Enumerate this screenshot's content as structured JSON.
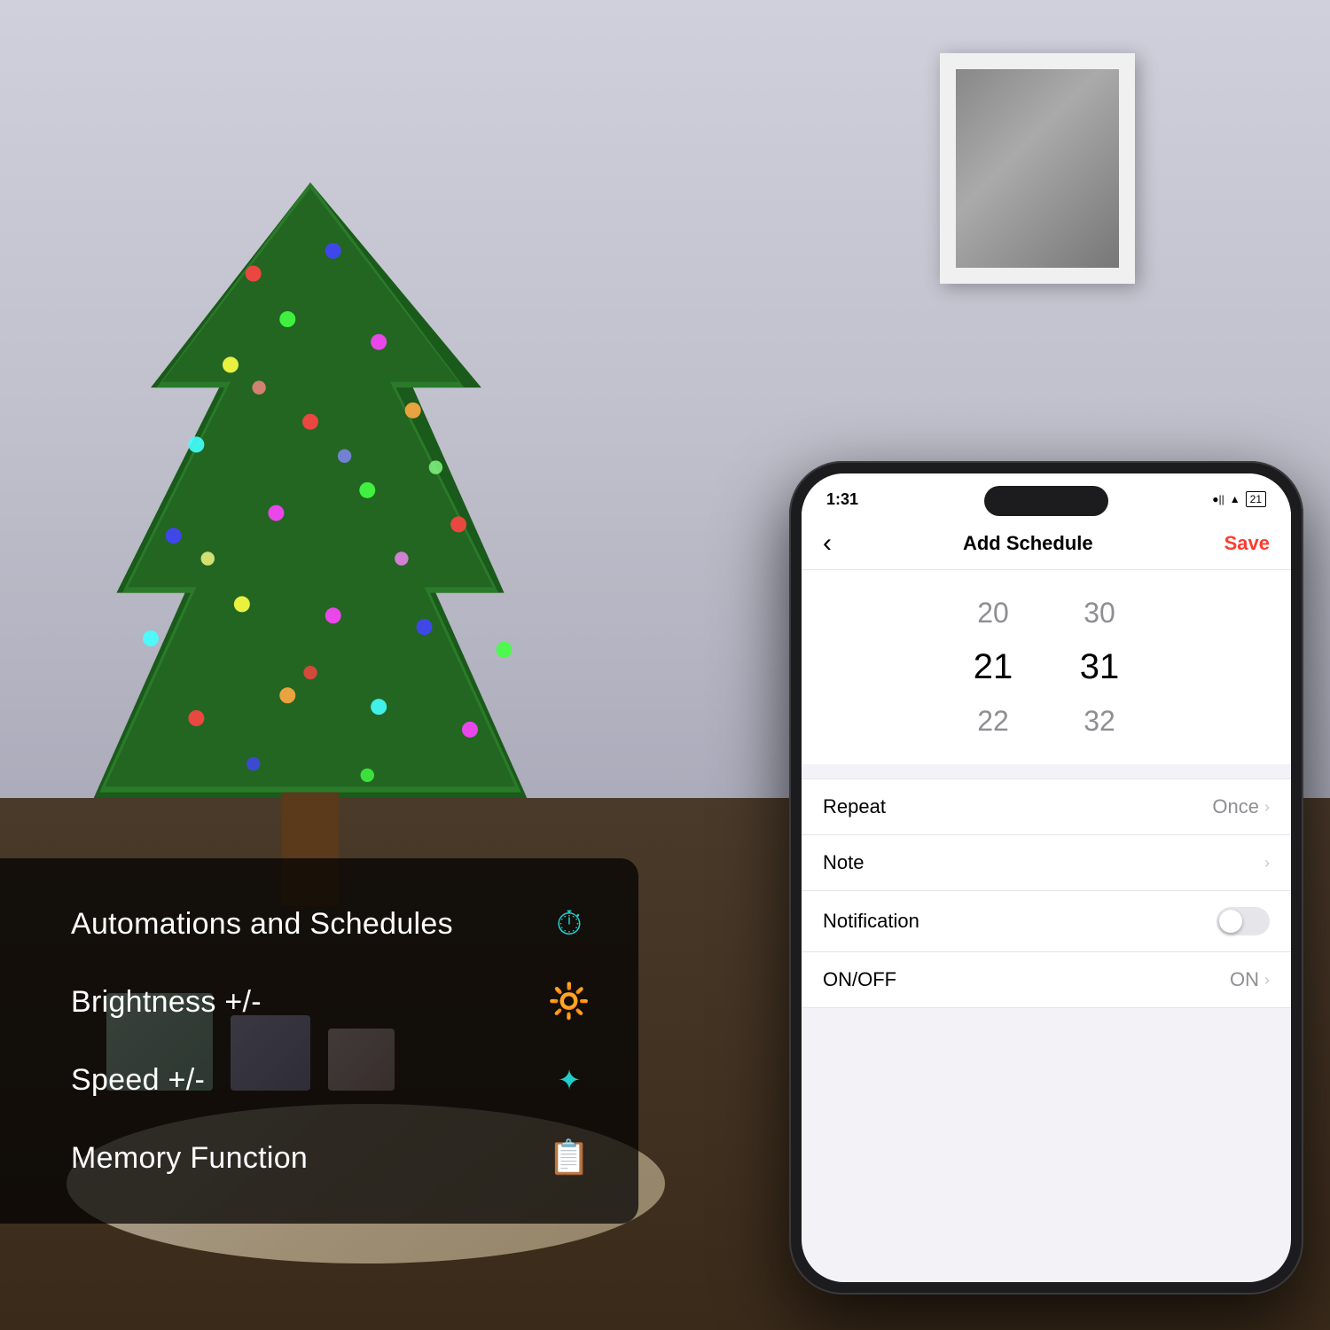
{
  "scene": {
    "bg_description": "Christmas tree with colorful lights in a living room"
  },
  "overlay": {
    "features": [
      {
        "id": "automations",
        "label": "Automations and Schedules",
        "icon": "⏱"
      },
      {
        "id": "brightness",
        "label": "Brightness +/-",
        "icon": "🔆"
      },
      {
        "id": "speed",
        "label": "Speed +/-",
        "icon": "☀"
      },
      {
        "id": "memory",
        "label": "Memory Function",
        "icon": "📱"
      }
    ]
  },
  "phone": {
    "status": {
      "time": "1:31",
      "icons": "●||⬛21"
    },
    "nav": {
      "back_label": "‹",
      "title": "Add Schedule",
      "save_label": "Save"
    },
    "time_picker": {
      "rows": [
        {
          "hour": "20",
          "minute": "30",
          "selected": false
        },
        {
          "hour": "21",
          "minute": "31",
          "selected": true
        },
        {
          "hour": "22",
          "minute": "32",
          "selected": false
        }
      ]
    },
    "list_items": [
      {
        "id": "repeat",
        "label": "Repeat",
        "value": "Once",
        "type": "nav"
      },
      {
        "id": "note",
        "label": "Note",
        "value": "",
        "type": "nav"
      },
      {
        "id": "notification",
        "label": "Notification",
        "value": "",
        "type": "toggle",
        "toggle_on": false
      },
      {
        "id": "onoff",
        "label": "ON/OFF",
        "value": "ON",
        "type": "nav"
      }
    ]
  }
}
